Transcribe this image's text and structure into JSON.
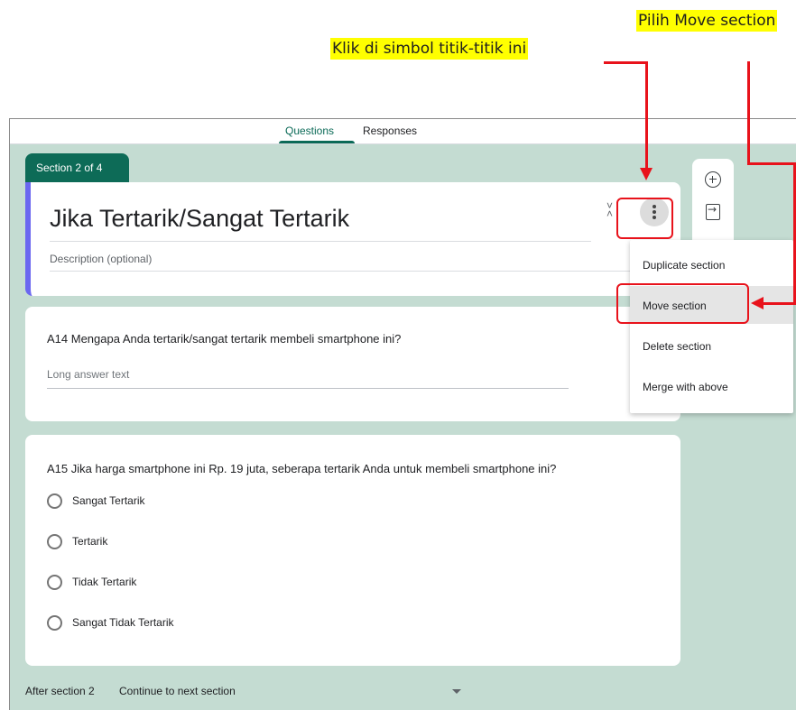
{
  "annotations": {
    "step_select": "Pilih Move section",
    "step_click": "Klik di simbol titik-titik ini"
  },
  "tabs": {
    "questions": "Questions",
    "responses": "Responses"
  },
  "section": {
    "badge": "Section 2 of 4",
    "title": "Jika Tertarik/Sangat Tertarik",
    "description_placeholder": "Description (optional)"
  },
  "questions": [
    {
      "title": "A14 Mengapa Anda tertarik/sangat tertarik membeli smartphone ini?",
      "answer_placeholder": "Long answer text"
    },
    {
      "title": "A15 Jika harga smartphone ini Rp. 19 juta, seberapa tertarik Anda untuk membeli smartphone ini?",
      "options": [
        "Sangat Tertarik",
        "Tertarik",
        "Tidak Tertarik",
        "Sangat Tidak Tertarik"
      ]
    }
  ],
  "after_section": {
    "label": "After section 2",
    "value": "Continue to next section"
  },
  "section_menu": {
    "items": [
      "Duplicate section",
      "Move section",
      "Delete section",
      "Merge with above"
    ],
    "highlighted": "Move section"
  },
  "colors": {
    "accent": "#0d6b57",
    "section_bar": "#6b67f0",
    "background": "#c4dcd2",
    "annotation_highlight": "#ffff00",
    "annotation_red": "#e8121b"
  },
  "icons": {
    "toolbar": [
      "add-question-icon",
      "import-questions-icon"
    ],
    "section_menu_button": "more-vert-icon",
    "collapse": "collapse-icon"
  }
}
